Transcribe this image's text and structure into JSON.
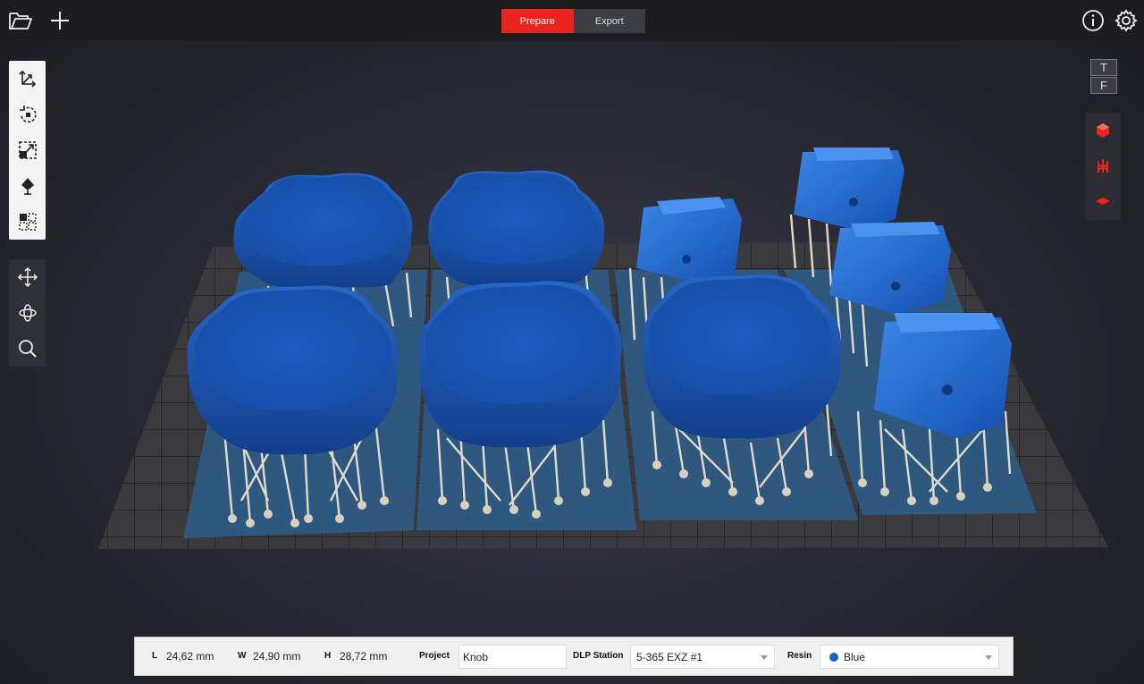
{
  "modes": {
    "prepare": "Prepare",
    "export": "Export",
    "active": "Prepare"
  },
  "icons": {
    "open": "folder-open-icon",
    "add": "plus-icon",
    "info": "info-icon",
    "settings": "gear-icon"
  },
  "left_tools": {
    "top": [
      "move-axes-icon",
      "rotate-icon",
      "scale-icon",
      "lay-flat-icon",
      "arrange-grid-icon"
    ],
    "bottom": [
      "pan-icon",
      "orbit-icon",
      "zoom-icon"
    ]
  },
  "view_cube": {
    "top": "T",
    "front": "F"
  },
  "right_tools": [
    "model-view-icon",
    "support-view-icon",
    "slice-view-icon"
  ],
  "colors": {
    "accent": "#e8241c",
    "model": "#1f5fc4",
    "support": "#d9d2c4",
    "platform": "#2d5a84"
  },
  "dimensions": {
    "L_label": "L",
    "L_value": "24,62 mm",
    "W_label": "W",
    "W_value": "24,90 mm",
    "H_label": "H",
    "H_value": "28,72 mm"
  },
  "project": {
    "label": "Project",
    "value": "Knob"
  },
  "station": {
    "label": "DLP Station",
    "value": "5-365 EXZ #1"
  },
  "resin": {
    "label": "Resin",
    "value": "Blue",
    "color": "#1a63c6"
  }
}
